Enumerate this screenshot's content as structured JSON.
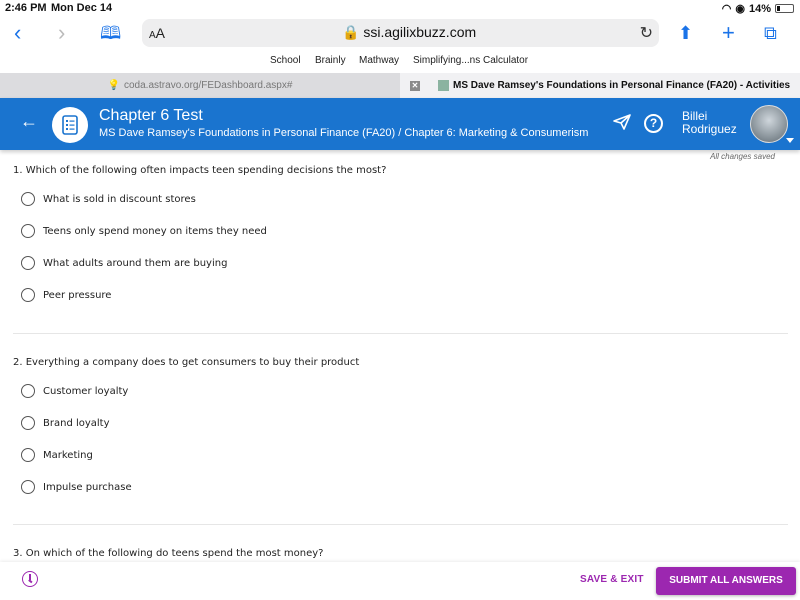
{
  "status_bar": {
    "time": "2:46 PM",
    "date": "Mon Dec 14",
    "battery": "14%"
  },
  "browser": {
    "address_aa": "AA",
    "url": "ssi.agilixbuzz.com",
    "bookmarks": [
      "School",
      "Brainly",
      "Mathway",
      "Simplifying...ns Calculator"
    ],
    "tabs": [
      {
        "label": "coda.astravo.org/FEDashboard.aspx#"
      },
      {
        "label": "MS Dave Ramsey's Foundations in Personal Finance (FA20) - Activities"
      }
    ]
  },
  "header": {
    "title": "Chapter 6 Test",
    "subtitle": "MS Dave Ramsey's Foundations in Personal Finance (FA20) / Chapter 6: Marketing & Consumerism",
    "help_label": "?",
    "user_first": "Billei",
    "user_last": "Rodriguez",
    "save_status": "All changes saved"
  },
  "questions": [
    {
      "text": "1. Which of the following often impacts teen spending decisions the most?",
      "options": [
        "What is sold in discount stores",
        "Teens only spend money on items they need",
        "What adults around them are buying",
        "Peer pressure"
      ]
    },
    {
      "text": "2. Everything a company does to get consumers to buy their product",
      "options": [
        "Customer loyalty",
        "Brand loyalty",
        "Marketing",
        "Impulse purchase"
      ]
    },
    {
      "text": "3. On which of the following do teens spend the most money?",
      "options": []
    }
  ],
  "footer": {
    "save_exit": "SAVE & EXIT",
    "submit": "SUBMIT ALL ANSWERS"
  },
  "colors": {
    "header_blue": "#1a74cf",
    "accent_purple": "#9c27b0"
  }
}
